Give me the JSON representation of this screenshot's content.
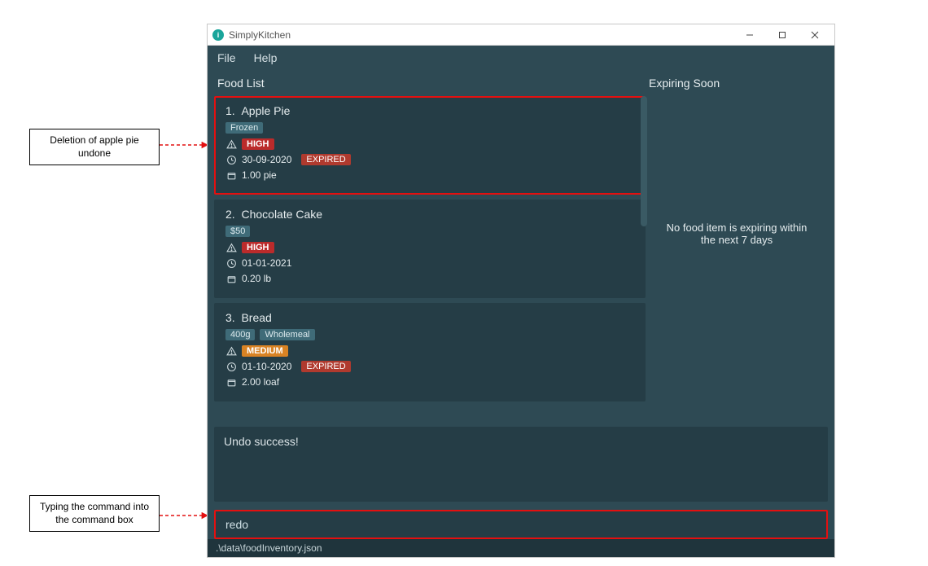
{
  "window": {
    "title": "SimplyKitchen"
  },
  "menubar": {
    "file": "File",
    "help": "Help"
  },
  "headers": {
    "food_list": "Food List",
    "expiring_soon": "Expiring Soon"
  },
  "food_list": [
    {
      "index": "1.",
      "name": "Apple Pie",
      "tags": [
        "Frozen"
      ],
      "priority": "HIGH",
      "date": "30-09-2020",
      "expired": "EXPIRED",
      "quantity": "1.00 pie",
      "highlighted": true
    },
    {
      "index": "2.",
      "name": "Chocolate Cake",
      "tags": [
        "$50"
      ],
      "priority": "HIGH",
      "date": "01-01-2021",
      "expired": null,
      "quantity": "0.20 lb",
      "highlighted": false
    },
    {
      "index": "3.",
      "name": "Bread",
      "tags": [
        "400g",
        "Wholemeal"
      ],
      "priority": "MEDIUM",
      "date": "01-10-2020",
      "expired": "EXPIRED",
      "quantity": "2.00 loaf",
      "highlighted": false
    }
  ],
  "expiring_soon_message": "No food item is expiring within the next 7 days",
  "output_message": "Undo success!",
  "command_input": "redo",
  "status_path": ".\\data\\foodInventory.json",
  "callouts": {
    "top": "Deletion of apple pie undone",
    "bottom": "Typing the command into the command box"
  }
}
